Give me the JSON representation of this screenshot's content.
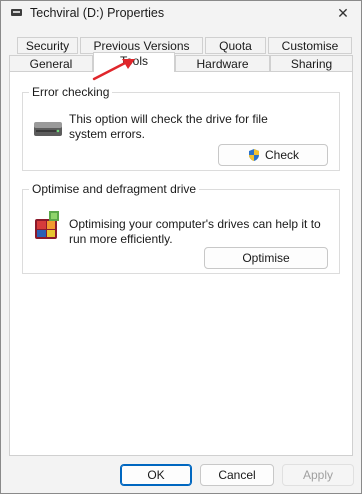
{
  "window": {
    "title": "Techviral (D:) Properties",
    "close_glyph": "✕"
  },
  "tabs": {
    "row1": [
      "Security",
      "Previous Versions",
      "Quota",
      "Customise"
    ],
    "row2": [
      "General",
      "Tools",
      "Hardware",
      "Sharing"
    ],
    "active": "Tools"
  },
  "error_checking": {
    "legend": "Error checking",
    "description": "This option will check the drive for file system errors.",
    "button_label": "Check",
    "icon": "drive-icon"
  },
  "optimise": {
    "legend": "Optimise and defragment drive",
    "description": "Optimising your computer's drives can help it to run more efficiently.",
    "button_label": "Optimise",
    "icon": "defrag-icon"
  },
  "footer": {
    "ok_label": "OK",
    "cancel_label": "Cancel",
    "apply_label": "Apply"
  },
  "annotation": {
    "arrow_color": "#e0262b"
  }
}
